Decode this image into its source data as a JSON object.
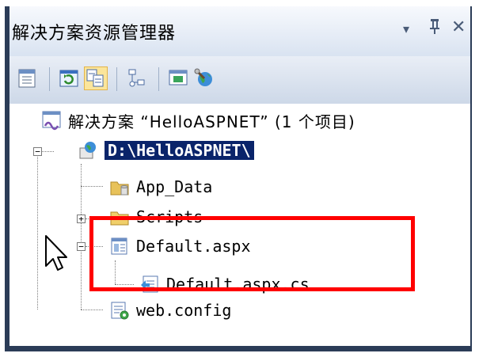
{
  "panel": {
    "title": "解决方案资源管理器",
    "dropdown_glyph": "▾",
    "pin_glyph": "ᴘ",
    "close_glyph": "✕"
  },
  "toolbar": {
    "buttons": [
      "properties-icon",
      "refresh-icon",
      "nest-related-files-icon",
      "view-class-diagram-icon",
      "view-designer-icon",
      "web-config-tool-icon"
    ],
    "active_button": "nest-related-files-icon"
  },
  "tree": {
    "solution": "解决方案 “HelloASPNET” (1 个项目)",
    "project": "D:\\HelloASPNET\\",
    "items": [
      {
        "label": "App_Data",
        "icon": "special-folder-icon"
      },
      {
        "label": "Scripts",
        "icon": "folder-icon"
      },
      {
        "label": "Default.aspx",
        "icon": "aspx-page-icon"
      },
      {
        "label": "Default.aspx.cs",
        "icon": "cs-codebehind-icon"
      },
      {
        "label": "web.config",
        "icon": "config-file-icon"
      }
    ]
  },
  "colors": {
    "highlight_box": "#ff0000",
    "selection": "#0a246a",
    "frame": "#2b3c57"
  }
}
